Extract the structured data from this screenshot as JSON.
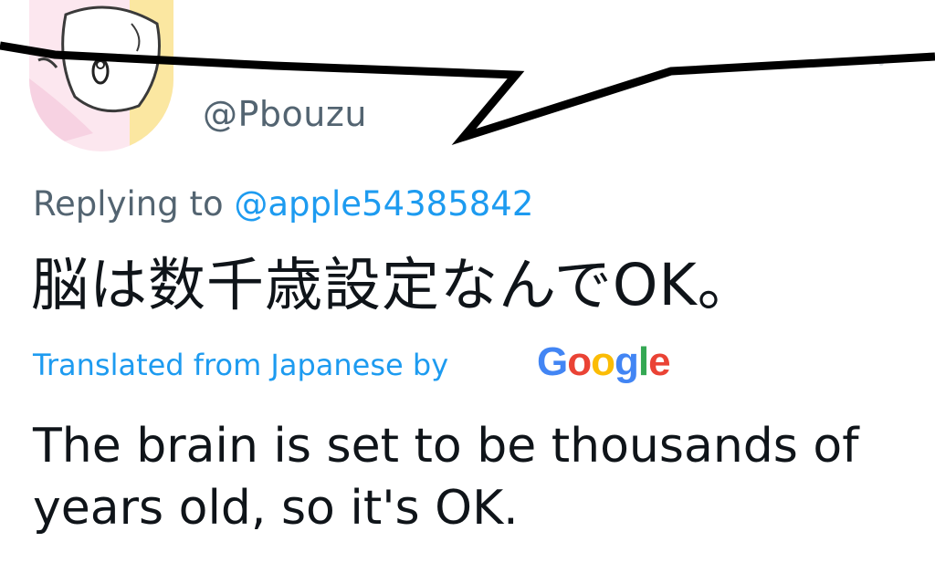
{
  "tweet": {
    "handle": "@Pbouzu",
    "replying_prefix": "Replying to ",
    "replying_mention": "@apple54385842",
    "original_text": "脳は数千歳設定なんでOK。",
    "translated_label": "Translated from Japanese by",
    "google_logo": {
      "letters": [
        "G",
        "o",
        "o",
        "g",
        "l",
        "e"
      ]
    },
    "translation": "The brain is set to be thousands of years old, so it's OK."
  },
  "colors": {
    "secondary_text": "#536471",
    "link": "#1d9bf0",
    "primary_text": "#0f1419",
    "google_blue": "#4285f4",
    "google_red": "#ea4335",
    "google_yellow": "#fbbc05",
    "google_green": "#34a853"
  },
  "icons": {
    "avatar": "cartoon-avatar-image",
    "overlay": "speech-bubble-outline"
  }
}
